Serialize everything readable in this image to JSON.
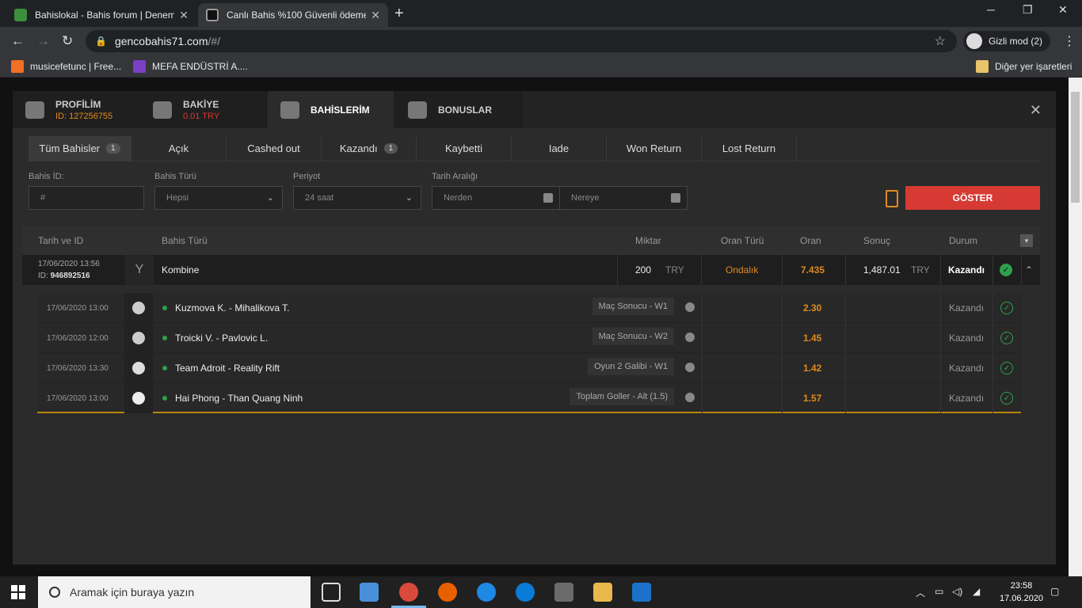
{
  "browser": {
    "tabs": [
      {
        "title": "Bahislokal - Bahis forum | Denem",
        "active": false
      },
      {
        "title": "Canlı Bahis %100 Güvenli ödeme",
        "active": true
      }
    ],
    "url_host": "gencobahis71.com",
    "url_path": "/#/",
    "incognito_label": "Gizli mod (2)",
    "bookmarks": [
      "musicefetunc | Free...",
      "MEFA ENDÜSTRİ A...."
    ],
    "other_bookmarks": "Diğer yer işaretleri"
  },
  "modal": {
    "tabs": [
      {
        "label": "PROFİLİM",
        "sub": "ID: 127256755",
        "icon": "user-icon"
      },
      {
        "label": "BAKİYE",
        "sub": "0.01 TRY",
        "icon": "wallet-icon"
      },
      {
        "label": "BAHİSLERİM",
        "sub": "",
        "icon": "trophy-icon"
      },
      {
        "label": "BONUSLAR",
        "sub": "",
        "icon": "gift-icon"
      }
    ],
    "filters": [
      {
        "label": "Tüm Bahisler",
        "count": "1"
      },
      {
        "label": "Açık",
        "count": ""
      },
      {
        "label": "Cashed out",
        "count": ""
      },
      {
        "label": "Kazandı",
        "count": "1"
      },
      {
        "label": "Kaybetti",
        "count": ""
      },
      {
        "label": "Iade",
        "count": ""
      },
      {
        "label": "Won Return",
        "count": ""
      },
      {
        "label": "Lost Return",
        "count": ""
      }
    ],
    "form": {
      "bet_id_label": "Bahis İD:",
      "bet_id_placeholder": "#",
      "bet_type_label": "Bahis Türü",
      "bet_type_value": "Hepsi",
      "period_label": "Periyot",
      "period_value": "24 saat",
      "date_label": "Tarih Aralığı",
      "from_placeholder": "Nerden",
      "to_placeholder": "Nereye",
      "submit": "GÖSTER"
    },
    "table": {
      "headers": [
        "Tarih ve ID",
        "Bahis Türü",
        "Miktar",
        "Oran Türü",
        "Oran",
        "Sonuç",
        "Durum"
      ],
      "bet": {
        "date": "17/06/2020 13:56",
        "id_label": "ID:",
        "id": "946892516",
        "type": "Kombine",
        "amount": "200",
        "currency": "TRY",
        "odds_type": "Ondalık",
        "odds": "7.435",
        "result": "1,487.01",
        "result_currency": "TRY",
        "status": "Kazandı"
      },
      "selections": [
        {
          "date": "17/06/2020 13:00",
          "sport": "tennis-icon",
          "match": "Kuzmova K. - Mihalikova T.",
          "market": "Maç Sonucu - W1",
          "odds": "2.30",
          "status": "Kazandı"
        },
        {
          "date": "17/06/2020 12:00",
          "sport": "tennis-icon",
          "match": "Troicki V. - Pavlovic L.",
          "market": "Maç Sonucu - W2",
          "odds": "1.45",
          "status": "Kazandı"
        },
        {
          "date": "17/06/2020 13:30",
          "sport": "dota-icon",
          "match": "Team Adroit - Reality Rift",
          "market": "Oyun 2 Galibi - W1",
          "odds": "1.42",
          "status": "Kazandı"
        },
        {
          "date": "17/06/2020 13:00",
          "sport": "soccer-icon",
          "match": "Hai Phong - Than Quang Ninh",
          "market": "Toplam Goller - Alt (1.5)",
          "odds": "1.57",
          "status": "Kazandı"
        }
      ]
    }
  },
  "taskbar": {
    "search_placeholder": "Aramak için buraya yazın",
    "time": "23:58",
    "date": "17.06.2020"
  },
  "colors": {
    "accent": "#e08a1e",
    "button": "#d63a32",
    "win": "#2ea04d"
  }
}
